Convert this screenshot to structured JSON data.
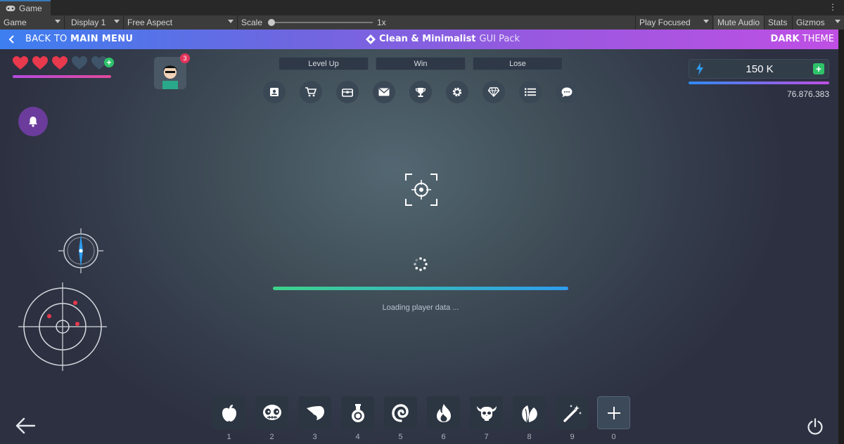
{
  "window": {
    "tab_label": "Game",
    "menu_icon": "kebab-icon"
  },
  "toolbar": {
    "view": "Game",
    "display": "Display 1",
    "aspect": "Free Aspect",
    "scale_label": "Scale",
    "scale_value": "1x",
    "play_mode": "Play Focused",
    "mute_audio": "Mute Audio",
    "stats": "Stats",
    "gizmos": "Gizmos"
  },
  "header": {
    "back_prefix": "BACK TO",
    "back_main": "MAIN MENU",
    "title_bold": "Clean & Minimalist",
    "title_light": "GUI Pack",
    "theme_bold": "DARK",
    "theme_light": "THEME"
  },
  "player": {
    "hearts_full": 3,
    "hearts_empty": 2,
    "notification_count": "3",
    "energy_value": "150 K",
    "coins": "76.876.383"
  },
  "buttons": {
    "level_up": "Level Up",
    "win": "Win",
    "lose": "Lose"
  },
  "menu_icons": [
    "profile-icon",
    "cart-icon",
    "chest-icon",
    "mail-icon",
    "trophy-icon",
    "settings-icon",
    "diamond-icon",
    "list-icon",
    "chat-icon"
  ],
  "loading": {
    "text": "Loading player data ...",
    "progress": 1.0
  },
  "slots": [
    {
      "num": "1",
      "icon": "apple-icon"
    },
    {
      "num": "2",
      "icon": "skull-icon"
    },
    {
      "num": "3",
      "icon": "wing-icon"
    },
    {
      "num": "4",
      "icon": "potion-icon"
    },
    {
      "num": "5",
      "icon": "swirl-icon"
    },
    {
      "num": "6",
      "icon": "fire-icon"
    },
    {
      "num": "7",
      "icon": "horned-skull-icon"
    },
    {
      "num": "8",
      "icon": "leaves-icon"
    },
    {
      "num": "9",
      "icon": "magic-wand-icon"
    },
    {
      "num": "0",
      "icon": "plus-icon"
    }
  ],
  "colors": {
    "accent_blue": "#3d7ff0",
    "accent_purple": "#c04fe4",
    "green": "#2ec36a",
    "heart_red": "#e8394d"
  }
}
